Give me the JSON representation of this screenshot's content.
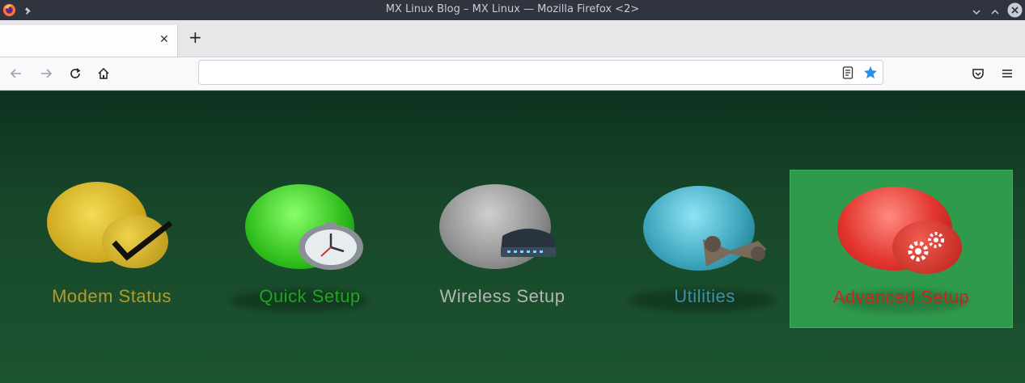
{
  "window": {
    "title": "MX Linux Blog – MX Linux — Mozilla Firefox <2>"
  },
  "tabs": [
    {
      "label": ""
    }
  ],
  "toolbar": {
    "url_value": ""
  },
  "menu_items": [
    {
      "label": "Modem Status",
      "color": "#b39a2a",
      "orb": "#e0c12c",
      "icon": "checkmark-icon"
    },
    {
      "label": "Quick Setup",
      "color": "#1fa51f",
      "orb": "#35c41e",
      "icon": "clock-icon"
    },
    {
      "label": "Wireless Setup",
      "color": "#b5b5b5",
      "orb": "#8e8e8e",
      "icon": "router-icon"
    },
    {
      "label": "Utilities",
      "color": "#3f8fa8",
      "orb": "#3aa3ba",
      "icon": "wrench-icon"
    },
    {
      "label": "Advanced Setup",
      "color": "#c9261f",
      "orb": "#e2352e",
      "icon": "gears-icon"
    }
  ],
  "selected": "Advanced Setup"
}
